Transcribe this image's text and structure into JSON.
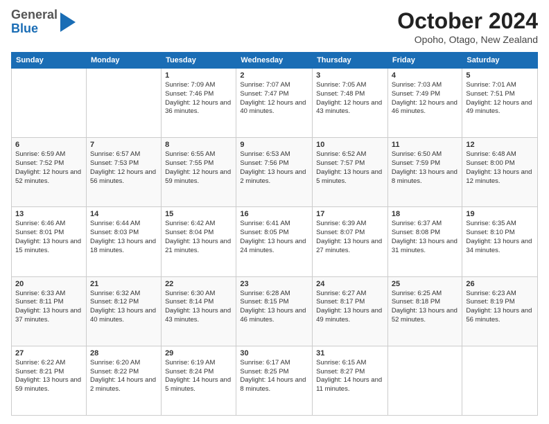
{
  "header": {
    "logo_general": "General",
    "logo_blue": "Blue",
    "month_title": "October 2024",
    "location": "Opoho, Otago, New Zealand"
  },
  "days_of_week": [
    "Sunday",
    "Monday",
    "Tuesday",
    "Wednesday",
    "Thursday",
    "Friday",
    "Saturday"
  ],
  "weeks": [
    [
      null,
      null,
      {
        "day": 1,
        "sunrise": "7:09 AM",
        "sunset": "7:46 PM",
        "daylight": "12 hours and 36 minutes."
      },
      {
        "day": 2,
        "sunrise": "7:07 AM",
        "sunset": "7:47 PM",
        "daylight": "12 hours and 40 minutes."
      },
      {
        "day": 3,
        "sunrise": "7:05 AM",
        "sunset": "7:48 PM",
        "daylight": "12 hours and 43 minutes."
      },
      {
        "day": 4,
        "sunrise": "7:03 AM",
        "sunset": "7:49 PM",
        "daylight": "12 hours and 46 minutes."
      },
      {
        "day": 5,
        "sunrise": "7:01 AM",
        "sunset": "7:51 PM",
        "daylight": "12 hours and 49 minutes."
      }
    ],
    [
      {
        "day": 6,
        "sunrise": "6:59 AM",
        "sunset": "7:52 PM",
        "daylight": "12 hours and 52 minutes."
      },
      {
        "day": 7,
        "sunrise": "6:57 AM",
        "sunset": "7:53 PM",
        "daylight": "12 hours and 56 minutes."
      },
      {
        "day": 8,
        "sunrise": "6:55 AM",
        "sunset": "7:55 PM",
        "daylight": "12 hours and 59 minutes."
      },
      {
        "day": 9,
        "sunrise": "6:53 AM",
        "sunset": "7:56 PM",
        "daylight": "13 hours and 2 minutes."
      },
      {
        "day": 10,
        "sunrise": "6:52 AM",
        "sunset": "7:57 PM",
        "daylight": "13 hours and 5 minutes."
      },
      {
        "day": 11,
        "sunrise": "6:50 AM",
        "sunset": "7:59 PM",
        "daylight": "13 hours and 8 minutes."
      },
      {
        "day": 12,
        "sunrise": "6:48 AM",
        "sunset": "8:00 PM",
        "daylight": "13 hours and 12 minutes."
      }
    ],
    [
      {
        "day": 13,
        "sunrise": "6:46 AM",
        "sunset": "8:01 PM",
        "daylight": "13 hours and 15 minutes."
      },
      {
        "day": 14,
        "sunrise": "6:44 AM",
        "sunset": "8:03 PM",
        "daylight": "13 hours and 18 minutes."
      },
      {
        "day": 15,
        "sunrise": "6:42 AM",
        "sunset": "8:04 PM",
        "daylight": "13 hours and 21 minutes."
      },
      {
        "day": 16,
        "sunrise": "6:41 AM",
        "sunset": "8:05 PM",
        "daylight": "13 hours and 24 minutes."
      },
      {
        "day": 17,
        "sunrise": "6:39 AM",
        "sunset": "8:07 PM",
        "daylight": "13 hours and 27 minutes."
      },
      {
        "day": 18,
        "sunrise": "6:37 AM",
        "sunset": "8:08 PM",
        "daylight": "13 hours and 31 minutes."
      },
      {
        "day": 19,
        "sunrise": "6:35 AM",
        "sunset": "8:10 PM",
        "daylight": "13 hours and 34 minutes."
      }
    ],
    [
      {
        "day": 20,
        "sunrise": "6:33 AM",
        "sunset": "8:11 PM",
        "daylight": "13 hours and 37 minutes."
      },
      {
        "day": 21,
        "sunrise": "6:32 AM",
        "sunset": "8:12 PM",
        "daylight": "13 hours and 40 minutes."
      },
      {
        "day": 22,
        "sunrise": "6:30 AM",
        "sunset": "8:14 PM",
        "daylight": "13 hours and 43 minutes."
      },
      {
        "day": 23,
        "sunrise": "6:28 AM",
        "sunset": "8:15 PM",
        "daylight": "13 hours and 46 minutes."
      },
      {
        "day": 24,
        "sunrise": "6:27 AM",
        "sunset": "8:17 PM",
        "daylight": "13 hours and 49 minutes."
      },
      {
        "day": 25,
        "sunrise": "6:25 AM",
        "sunset": "8:18 PM",
        "daylight": "13 hours and 52 minutes."
      },
      {
        "day": 26,
        "sunrise": "6:23 AM",
        "sunset": "8:19 PM",
        "daylight": "13 hours and 56 minutes."
      }
    ],
    [
      {
        "day": 27,
        "sunrise": "6:22 AM",
        "sunset": "8:21 PM",
        "daylight": "13 hours and 59 minutes."
      },
      {
        "day": 28,
        "sunrise": "6:20 AM",
        "sunset": "8:22 PM",
        "daylight": "14 hours and 2 minutes."
      },
      {
        "day": 29,
        "sunrise": "6:19 AM",
        "sunset": "8:24 PM",
        "daylight": "14 hours and 5 minutes."
      },
      {
        "day": 30,
        "sunrise": "6:17 AM",
        "sunset": "8:25 PM",
        "daylight": "14 hours and 8 minutes."
      },
      {
        "day": 31,
        "sunrise": "6:15 AM",
        "sunset": "8:27 PM",
        "daylight": "14 hours and 11 minutes."
      },
      null,
      null
    ]
  ]
}
